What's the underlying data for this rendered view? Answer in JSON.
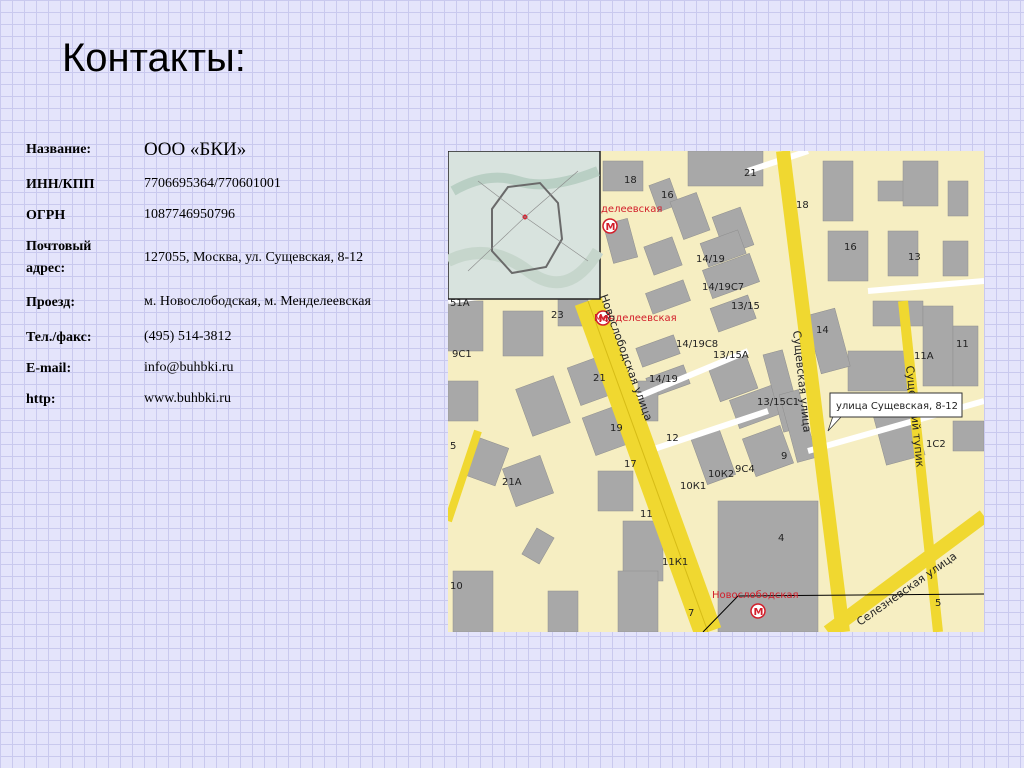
{
  "title": "Контакты:",
  "contacts": [
    {
      "label": "Название:",
      "value": "ООО «БКИ»"
    },
    {
      "label": "ИНН/КПП",
      "value": "7706695364/770601001"
    },
    {
      "label": "ОГРН",
      "value": "1087746950796"
    },
    {
      "label_line1": "Почтовый",
      "label_line2": "адрес:",
      "value": "127055, Москва, ул. Сущевская, 8-12"
    },
    {
      "label": "Проезд:",
      "value": "м. Новослободская, м. Менделеевская"
    },
    {
      "label": "Тел./факс:",
      "value": "(495) 514-3812"
    },
    {
      "label": "E-mail:",
      "value": "info@buhbki.ru"
    },
    {
      "label": "http:",
      "value": "www.buhbki.ru"
    }
  ],
  "map": {
    "callout": "улица Сущевская, 8-12",
    "streets": {
      "novoslobodskaya": "Новослободская улица",
      "sushchevskaya": "Сущевская улица",
      "seleznevskaya": "Селезневская улица",
      "tupik": "Сущевский тупик"
    },
    "metro": {
      "mendeleevskaya_top": "делеевская",
      "mendeleevskaya": "Менделеевская",
      "novoslobodskaya": "Новослободская",
      "icon": "metro-icon"
    },
    "buildings": {
      "b18a": "18",
      "b16a": "16",
      "b21top": "21",
      "b18b": "18",
      "b16b": "16",
      "b13": "13",
      "b14_19": "14/19",
      "b14_19c7": "14/19С7",
      "b13_15": "13/15",
      "b23": "23",
      "b14_19c8": "14/19С8",
      "b13_15a": "13/15А",
      "b14": "14",
      "b11a": "11А",
      "b11": "11",
      "b9c1": "9С1",
      "b21": "21",
      "b14_19b": "14/19",
      "b13_15c1": "13/15С1",
      "b19": "19",
      "b12": "12",
      "b5": "5",
      "b17": "17",
      "b10k2": "10К2",
      "b9c4": "9С4",
      "b9": "9",
      "b1c2": "1С2",
      "b21a": "21А",
      "b10k1": "10К1",
      "b11b": "11",
      "b4": "4",
      "b11k1": "11К1",
      "b10": "10",
      "b7": "7",
      "b5b": "5",
      "b51a": "51А"
    }
  }
}
